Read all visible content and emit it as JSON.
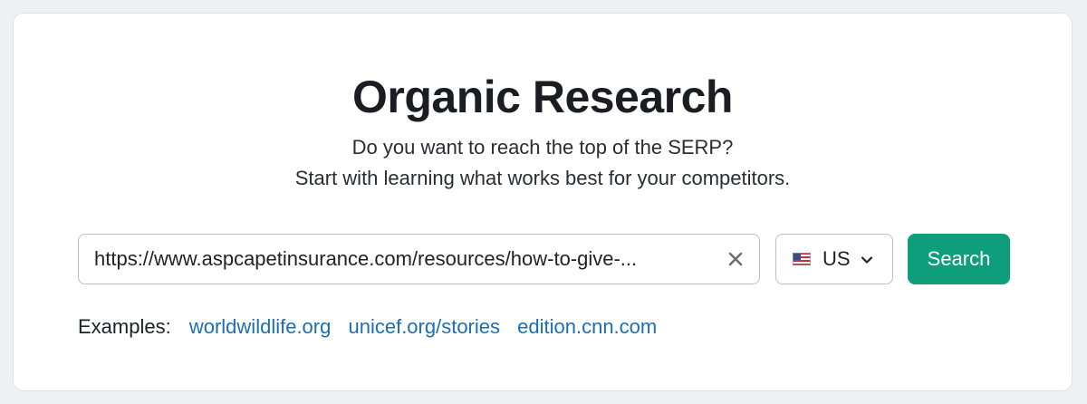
{
  "header": {
    "title": "Organic Research",
    "subtitle_line1": "Do you want to reach the top of the SERP?",
    "subtitle_line2": "Start with learning what works best for your competitors."
  },
  "search": {
    "value": "https://www.aspcapetinsurance.com/resources/how-to-give-...",
    "clear_icon": "close-icon"
  },
  "country": {
    "flag_icon": "us-flag-icon",
    "selected": "US",
    "dropdown_icon": "chevron-down-icon"
  },
  "search_button": {
    "label": "Search"
  },
  "examples": {
    "label": "Examples:",
    "links": [
      "worldwildlife.org",
      "unicef.org/stories",
      "edition.cnn.com"
    ]
  },
  "colors": {
    "accent": "#0e9e7b",
    "link": "#1a6fb5",
    "background": "#eef0f4"
  }
}
